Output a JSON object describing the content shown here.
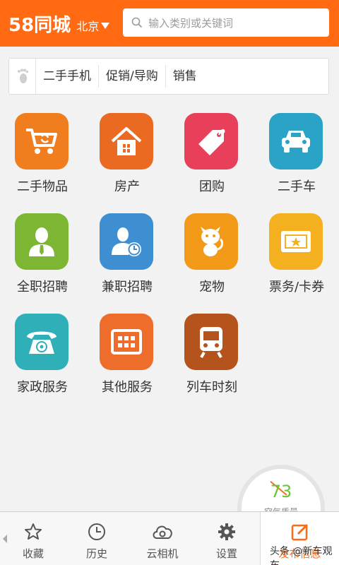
{
  "header": {
    "brand": "58同城",
    "city": "北京",
    "search_placeholder": "输入类别或关键词"
  },
  "history": {
    "tags": [
      "二手手机",
      "促销/导购",
      "销售"
    ]
  },
  "categories": [
    {
      "label": "二手物品",
      "icon": "shopping-cart-icon",
      "color": "#f07d1e"
    },
    {
      "label": "房产",
      "icon": "house-icon",
      "color": "#eb6a22"
    },
    {
      "label": "团购",
      "icon": "price-tag-icon",
      "color": "#e8405a"
    },
    {
      "label": "二手车",
      "icon": "car-icon",
      "color": "#2aa3c6"
    },
    {
      "label": "全职招聘",
      "icon": "person-tie-icon",
      "color": "#7db632"
    },
    {
      "label": "兼职招聘",
      "icon": "person-clock-icon",
      "color": "#3d8fd1"
    },
    {
      "label": "宠物",
      "icon": "pet-icon",
      "color": "#f29a18"
    },
    {
      "label": "票务/卡券",
      "icon": "ticket-icon",
      "color": "#f5b020"
    },
    {
      "label": "家政服务",
      "icon": "telephone-icon",
      "color": "#2fb0b8"
    },
    {
      "label": "其他服务",
      "icon": "grid-box-icon",
      "color": "#ef6d2a"
    },
    {
      "label": "列车时刻",
      "icon": "train-icon",
      "color": "#b5531c"
    }
  ],
  "air_quality": {
    "value": "73",
    "label": "空气质量"
  },
  "tabbar": {
    "items": [
      {
        "label": "收藏",
        "icon": "star-icon"
      },
      {
        "label": "历史",
        "icon": "clock-icon"
      },
      {
        "label": "云相机",
        "icon": "cloud-camera-icon"
      },
      {
        "label": "设置",
        "icon": "gear-icon"
      },
      {
        "label": "发布信息",
        "icon": "edit-icon"
      }
    ]
  },
  "watermark": "头条 @新车观车",
  "colors": {
    "brand_orange": "#ff6a13",
    "air_green": "#69c43a"
  }
}
